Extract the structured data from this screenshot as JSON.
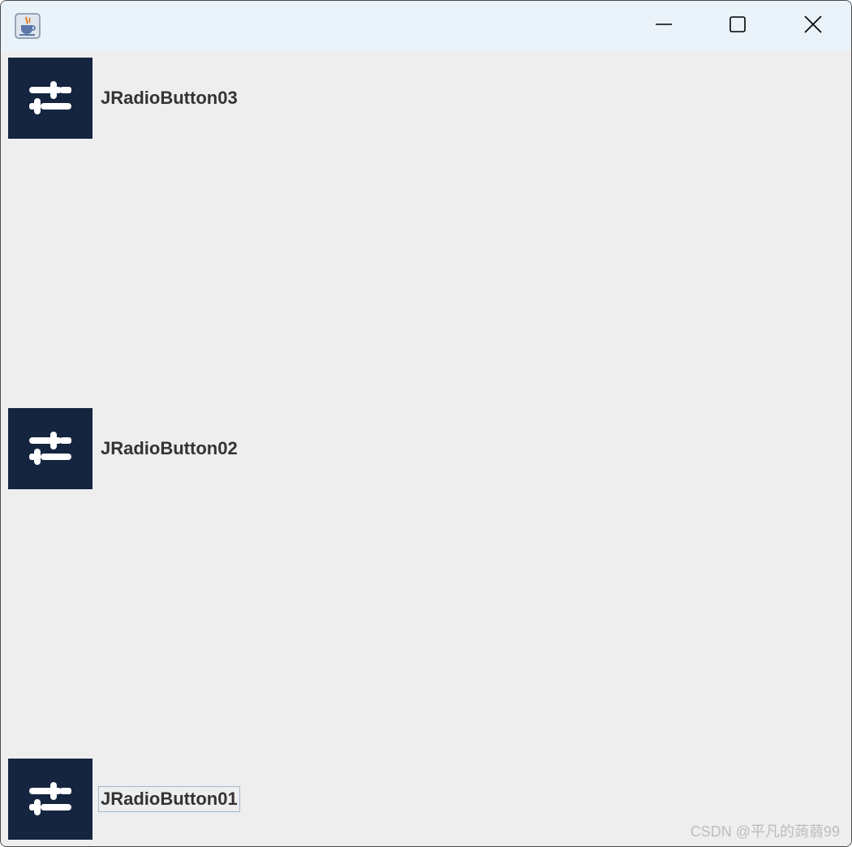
{
  "window": {
    "title": "",
    "app_icon": "java-coffee-icon",
    "controls": {
      "minimize_icon": "minimize-icon",
      "maximize_icon": "maximize-icon",
      "close_icon": "close-icon"
    }
  },
  "radio_buttons": [
    {
      "label": "JRadioButton03",
      "icon": "sliders-icon",
      "focused": false
    },
    {
      "label": "JRadioButton02",
      "icon": "sliders-icon",
      "focused": false
    },
    {
      "label": "JRadioButton01",
      "icon": "sliders-icon",
      "focused": true
    }
  ],
  "watermark": "CSDN @平凡的蒟蒻99",
  "colors": {
    "titlebar": "#eaf3f9",
    "background": "#eeeeee",
    "icon_bg": "#152540",
    "icon_fg": "#ffffff",
    "label_text": "#333333",
    "focus_border": "#a3b8cc"
  }
}
